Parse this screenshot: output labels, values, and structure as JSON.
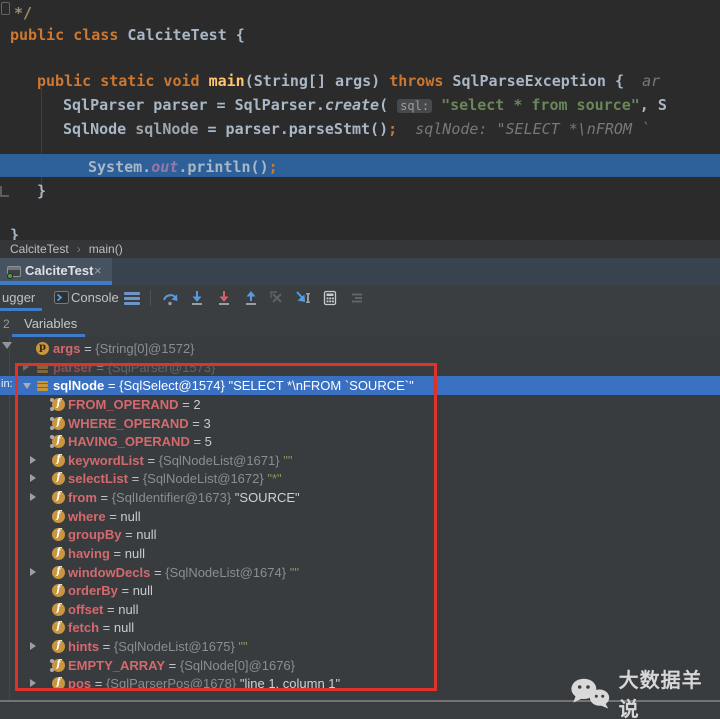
{
  "colors": {
    "accent_blue": "#3E7CC9",
    "selection_blue": "#3A70C1",
    "exec_line_blue": "#2D6099",
    "annotation_red": "#DF332A",
    "variable_name_pink": "#D4696E",
    "string_green": "#6A8759",
    "field_icon_amber": "#C9953F",
    "editor_bg": "#2B2B2B"
  },
  "editor": {
    "lines": [
      {
        "segments": [
          {
            "t": "*/",
            "c": "cmt"
          }
        ]
      },
      {
        "segments": [
          {
            "t": "public class ",
            "c": "kw"
          },
          {
            "t": "CalciteTest {",
            "c": "plain"
          }
        ]
      },
      {
        "segments": [
          {
            "t": "public static void ",
            "c": "kw"
          },
          {
            "t": "main",
            "c": "method"
          },
          {
            "t": "(String[] args) ",
            "c": "plain"
          },
          {
            "t": "throws",
            "c": "kw"
          },
          {
            "t": " SqlParseException {",
            "c": "plain"
          },
          {
            "t": "  ar",
            "c": "hint"
          }
        ]
      },
      {
        "segments": [
          {
            "t": "SqlParser parser = SqlParser.",
            "c": "plain"
          },
          {
            "t": "create",
            "c": "italic"
          },
          {
            "t": "( ",
            "c": "plain"
          },
          {
            "t": "sql:",
            "c": "chip"
          },
          {
            "t": " ",
            "c": "plain"
          },
          {
            "t": "\"select * from source\"",
            "c": "str"
          },
          {
            "t": ", S",
            "c": "plain"
          }
        ]
      },
      {
        "segments": [
          {
            "t": "SqlNode ",
            "c": "plain"
          },
          {
            "t": "sqlNode",
            "c": "dimvar"
          },
          {
            "t": " = parser.parseStmt()",
            "c": "plain"
          },
          {
            "t": ";",
            "c": "kw"
          },
          {
            "t": "  sqlNode: \"SELECT *\\nFROM `",
            "c": "hint"
          }
        ]
      },
      {
        "highlight": true,
        "segments": [
          {
            "t": "System.",
            "c": "plain"
          },
          {
            "t": "out",
            "c": "out"
          },
          {
            "t": ".println()",
            "c": "plain"
          },
          {
            "t": ";",
            "c": "kw"
          }
        ]
      },
      {
        "segments": [
          {
            "t": "}",
            "c": "plain"
          }
        ]
      },
      {
        "segments": [
          {
            "t": "}",
            "c": "plain"
          }
        ]
      }
    ]
  },
  "breadcrumb": {
    "items": [
      "CalciteTest",
      "main()"
    ],
    "separator": "›"
  },
  "editor_tab": {
    "label": "CalciteTest",
    "close": "×"
  },
  "debug_panel": {
    "left_tab_partial": "ugger",
    "console_tab": "Console",
    "toolbar_icons": [
      "layout-menu",
      "step-over",
      "step-into",
      "force-step-into",
      "step-out",
      "drop-frame",
      "run-to-cursor",
      "evaluate-expression",
      "trace-settings"
    ]
  },
  "vars_panel": {
    "left_partial": "2",
    "tab": "Variables"
  },
  "variables": {
    "frame_partial": "in:",
    "rows": [
      {
        "name": "args",
        "icon": "param",
        "value": [
          {
            "t": "{String[0]@1572}",
            "c": "ref"
          }
        ]
      },
      {
        "name": "parser",
        "icon": "var",
        "dim": true,
        "expandable": true,
        "value": [
          {
            "t": "{SqlParser@1573}",
            "c": "ref"
          }
        ]
      },
      {
        "name": "sqlNode",
        "icon": "var",
        "selected": true,
        "expandable": true,
        "expanded": true,
        "value": [
          {
            "t": "{SqlSelect@1574} ",
            "c": "ref"
          },
          {
            "t": "\"SELECT *\\nFROM `SOURCE`\"",
            "c": "strw"
          }
        ]
      },
      {
        "name": "FROM_OPERAND",
        "icon": "field",
        "static": true,
        "child": true,
        "value": [
          {
            "t": "2",
            "c": "num"
          }
        ]
      },
      {
        "name": "WHERE_OPERAND",
        "icon": "field",
        "static": true,
        "child": true,
        "value": [
          {
            "t": "3",
            "c": "num"
          }
        ]
      },
      {
        "name": "HAVING_OPERAND",
        "icon": "field",
        "static": true,
        "child": true,
        "value": [
          {
            "t": "5",
            "c": "num"
          }
        ]
      },
      {
        "name": "keywordList",
        "icon": "field",
        "child": true,
        "expandable": true,
        "value": [
          {
            "t": "{SqlNodeList@1671} ",
            "c": "ref"
          },
          {
            "t": "\"\"",
            "c": "strg"
          }
        ]
      },
      {
        "name": "selectList",
        "icon": "field",
        "child": true,
        "expandable": true,
        "value": [
          {
            "t": "{SqlNodeList@1672} ",
            "c": "ref"
          },
          {
            "t": "\"*\"",
            "c": "strg"
          }
        ]
      },
      {
        "name": "from",
        "icon": "field",
        "child": true,
        "expandable": true,
        "value": [
          {
            "t": "{SqlIdentifier@1673} ",
            "c": "ref"
          },
          {
            "t": "\"SOURCE\"",
            "c": "strw"
          }
        ]
      },
      {
        "name": "where",
        "icon": "field",
        "child": true,
        "value": [
          {
            "t": "null",
            "c": "num"
          }
        ]
      },
      {
        "name": "groupBy",
        "icon": "field",
        "child": true,
        "value": [
          {
            "t": "null",
            "c": "num"
          }
        ]
      },
      {
        "name": "having",
        "icon": "field",
        "child": true,
        "value": [
          {
            "t": "null",
            "c": "num"
          }
        ]
      },
      {
        "name": "windowDecls",
        "icon": "field",
        "child": true,
        "expandable": true,
        "value": [
          {
            "t": "{SqlNodeList@1674} ",
            "c": "ref"
          },
          {
            "t": "\"\"",
            "c": "strg"
          }
        ]
      },
      {
        "name": "orderBy",
        "icon": "field",
        "child": true,
        "value": [
          {
            "t": "null",
            "c": "num"
          }
        ]
      },
      {
        "name": "offset",
        "icon": "field",
        "child": true,
        "value": [
          {
            "t": "null",
            "c": "num"
          }
        ]
      },
      {
        "name": "fetch",
        "icon": "field",
        "child": true,
        "value": [
          {
            "t": "null",
            "c": "num"
          }
        ]
      },
      {
        "name": "hints",
        "icon": "field",
        "child": true,
        "expandable": true,
        "value": [
          {
            "t": "{SqlNodeList@1675} ",
            "c": "ref"
          },
          {
            "t": "\"\"",
            "c": "strg"
          }
        ]
      },
      {
        "name": "EMPTY_ARRAY",
        "icon": "field",
        "static": true,
        "child": true,
        "value": [
          {
            "t": "{SqlNode[0]@1676}",
            "c": "ref"
          }
        ]
      },
      {
        "name": "pos",
        "icon": "field",
        "child": true,
        "expandable": true,
        "value": [
          {
            "t": "{SqlParserPos@1678} ",
            "c": "ref"
          },
          {
            "t": "\"line 1, column 1\"",
            "c": "strw"
          }
        ]
      }
    ]
  },
  "watermark": {
    "text": "大数据羊说"
  }
}
